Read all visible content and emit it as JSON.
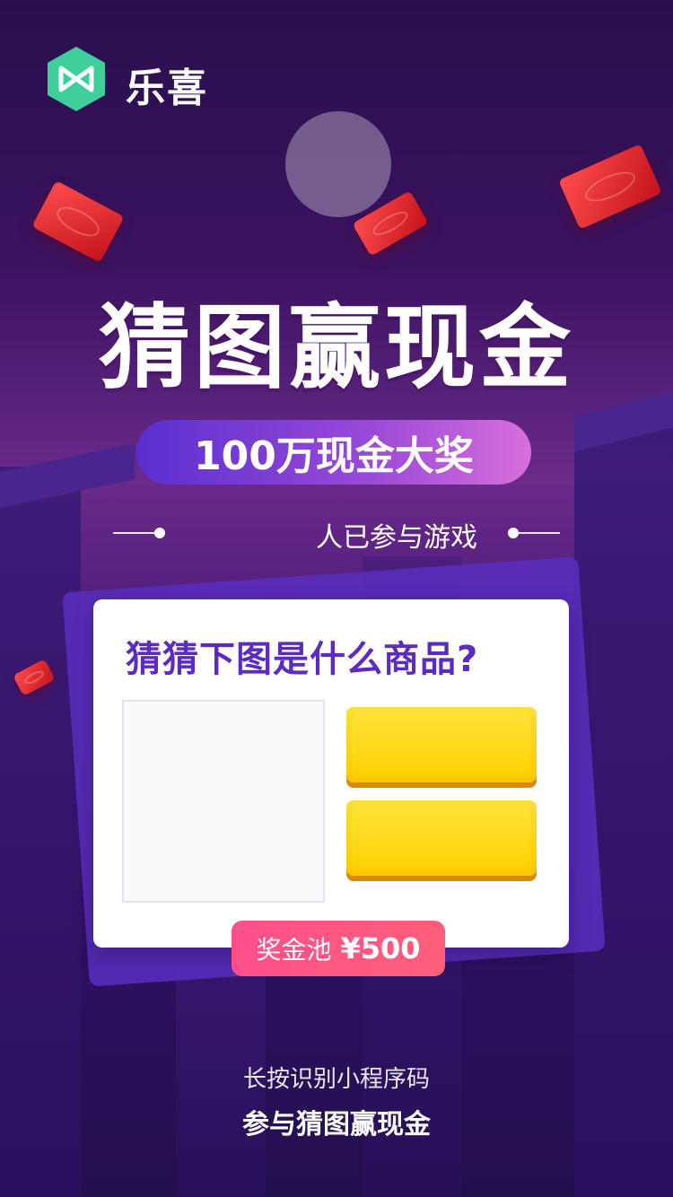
{
  "brand": {
    "name": "乐喜",
    "logo_icon": "ribbon-logo-icon",
    "logo_color": "#3ecf9a"
  },
  "hero": {
    "title": "猜图赢现金",
    "prize_pill": "100万现金大奖",
    "participants_text": "人已参与游戏"
  },
  "quiz": {
    "question": "猜猜下图是什么商品?",
    "options": [
      {
        "label": ""
      },
      {
        "label": ""
      }
    ],
    "prize_pool_label": "奖金池",
    "prize_pool_value": "¥500"
  },
  "footer": {
    "line1": "长按识别小程序码",
    "line2": "参与猜图赢现金"
  },
  "colors": {
    "accent_purple": "#5b2bc3",
    "option_yellow": "#ffd000",
    "prize_pink": "#ff4f8b",
    "redpack_red": "#e0222a"
  }
}
